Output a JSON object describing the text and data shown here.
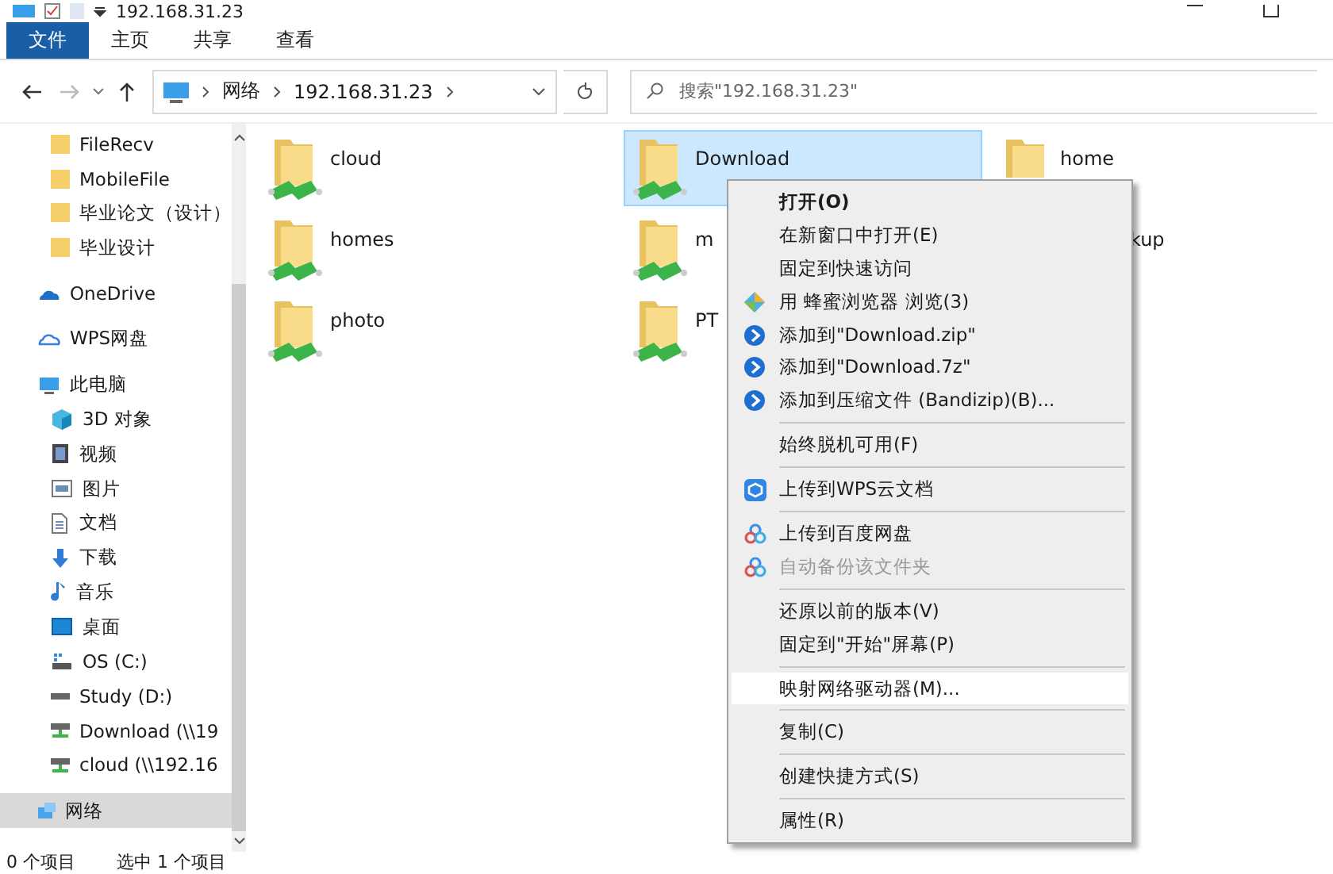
{
  "window": {
    "title": "192.168.31.23"
  },
  "ribbon_tabs": [
    {
      "label": "文件",
      "selected": true
    },
    {
      "label": "主页",
      "selected": false
    },
    {
      "label": "共享",
      "selected": false
    },
    {
      "label": "查看",
      "selected": false
    }
  ],
  "address_bar": {
    "path": [
      "网络",
      "192.168.31.23"
    ]
  },
  "search": {
    "placeholder": "搜索\"192.168.31.23\""
  },
  "sidebar": {
    "quick_access": [
      {
        "label": "FileRecv",
        "kind": "folder",
        "selected": false
      },
      {
        "label": "MobileFile",
        "kind": "folder",
        "selected": false
      },
      {
        "label": "毕业论文（设计）",
        "kind": "folder",
        "selected": false
      },
      {
        "label": "毕业设计",
        "kind": "folder",
        "selected": false
      }
    ],
    "items": [
      {
        "label": "OneDrive",
        "kind": "onedrive",
        "selected": false
      },
      {
        "label": "WPS网盘",
        "kind": "cloud",
        "selected": false
      },
      {
        "label": "此电脑",
        "kind": "computer",
        "selected": false,
        "children": [
          {
            "label": "3D 对象",
            "kind": "cube",
            "selected": false
          },
          {
            "label": "视频",
            "kind": "video",
            "selected": false
          },
          {
            "label": "图片",
            "kind": "picture",
            "selected": false
          },
          {
            "label": "文档",
            "kind": "document",
            "selected": false
          },
          {
            "label": "下载",
            "kind": "download",
            "selected": false
          },
          {
            "label": "音乐",
            "kind": "music",
            "selected": false
          },
          {
            "label": "桌面",
            "kind": "desktop",
            "selected": false
          },
          {
            "label": "OS (C:)",
            "kind": "system",
            "selected": false
          },
          {
            "label": "Study (D:)",
            "kind": "drive",
            "selected": false
          },
          {
            "label": "Download (\\\\19",
            "kind": "netdrive",
            "selected": false
          },
          {
            "label": "cloud (\\\\192.16",
            "kind": "netdrive",
            "selected": false
          }
        ]
      },
      {
        "label": "网络",
        "kind": "network",
        "selected": true
      }
    ]
  },
  "folders": [
    {
      "name": "cloud",
      "kind": "folder",
      "selected": false
    },
    {
      "name": "Download",
      "kind": "folder",
      "selected": true
    },
    {
      "name": "home",
      "kind": "partial",
      "selected": false
    },
    {
      "name": "homes",
      "kind": "folder",
      "selected": false
    },
    {
      "name": "m",
      "kind": "folder",
      "selected": false
    },
    {
      "name": "kup",
      "kind": "covered",
      "selected": false
    },
    {
      "name": "photo",
      "kind": "folder",
      "selected": false
    },
    {
      "name": "PT",
      "kind": "folder",
      "selected": false
    }
  ],
  "context_menu": [
    {
      "kind": "plain",
      "label": "打开(O)",
      "default": true,
      "disabled": false,
      "selected": false
    },
    {
      "kind": "plain",
      "label": "在新窗口中打开(E)",
      "default": false,
      "disabled": false,
      "selected": false
    },
    {
      "kind": "plain",
      "label": "固定到快速访问",
      "default": false,
      "disabled": false,
      "selected": false
    },
    {
      "kind": "browser",
      "label": "用 蜂蜜浏览器 浏览(3)",
      "default": false,
      "disabled": false,
      "selected": false
    },
    {
      "kind": "archiver",
      "label": "添加到\"Download.zip\"",
      "default": false,
      "disabled": false,
      "selected": false
    },
    {
      "kind": "archiver",
      "label": "添加到\"Download.7z\"",
      "default": false,
      "disabled": false,
      "selected": false
    },
    {
      "kind": "archiver",
      "label": "添加到压缩文件 (Bandizip)(B)...",
      "default": false,
      "disabled": false,
      "selected": false
    },
    {
      "kind": "separator"
    },
    {
      "kind": "plain",
      "label": "始终脱机可用(F)",
      "default": false,
      "disabled": false,
      "selected": false
    },
    {
      "kind": "separator"
    },
    {
      "kind": "wps",
      "label": "上传到WPS云文档",
      "default": false,
      "disabled": false,
      "selected": false
    },
    {
      "kind": "separator"
    },
    {
      "kind": "baidu",
      "label": "上传到百度网盘",
      "default": false,
      "disabled": false,
      "selected": false
    },
    {
      "kind": "baidu",
      "label": "自动备份该文件夹",
      "default": false,
      "disabled": true,
      "selected": false
    },
    {
      "kind": "separator"
    },
    {
      "kind": "plain",
      "label": "还原以前的版本(V)",
      "default": false,
      "disabled": false,
      "selected": false
    },
    {
      "kind": "plain",
      "label": "固定到\"开始\"屏幕(P)",
      "default": false,
      "disabled": false,
      "selected": false
    },
    {
      "kind": "separator"
    },
    {
      "kind": "plain",
      "label": "映射网络驱动器(M)...",
      "default": false,
      "disabled": false,
      "selected": true
    },
    {
      "kind": "separator"
    },
    {
      "kind": "plain",
      "label": "复制(C)",
      "default": false,
      "disabled": false,
      "selected": false
    },
    {
      "kind": "separator"
    },
    {
      "kind": "plain",
      "label": "创建快捷方式(S)",
      "default": false,
      "disabled": false,
      "selected": false
    },
    {
      "kind": "separator"
    },
    {
      "kind": "plain",
      "label": "属性(R)",
      "default": false,
      "disabled": false,
      "selected": false
    }
  ],
  "status_bar": {
    "item_count": "0 个项目",
    "selection": "选中 1 个项目"
  }
}
